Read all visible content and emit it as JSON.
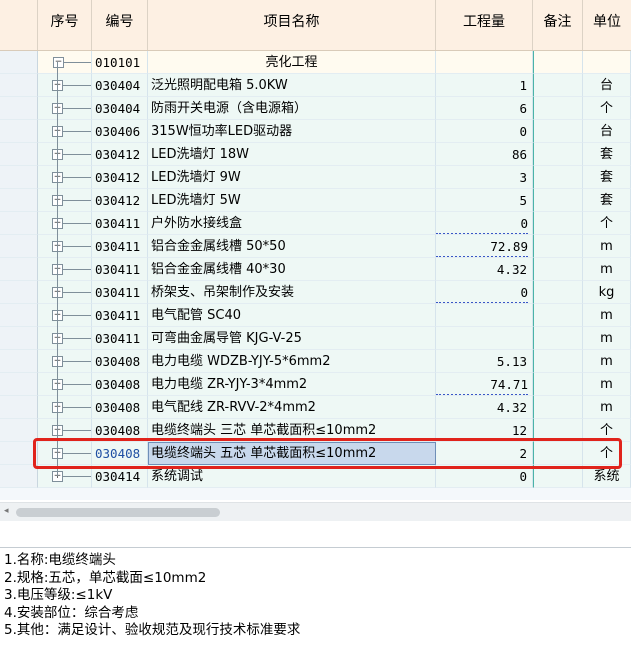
{
  "table": {
    "headers": {
      "seq": "序号",
      "code": "编号",
      "name": "项目名称",
      "quantity": "工程量",
      "remark": "备注",
      "unit": "单位"
    },
    "group": {
      "code": "010101",
      "name": "亮化工程"
    },
    "rows": [
      {
        "code": "030404",
        "name": "泛光照明配电箱 5.0KW",
        "quantity": "1",
        "unit": "台"
      },
      {
        "code": "030404",
        "name": "防雨开关电源（含电源箱）",
        "quantity": "6",
        "unit": "个"
      },
      {
        "code": "030406",
        "name": "315W恒功率LED驱动器",
        "quantity": "0",
        "unit": "台"
      },
      {
        "code": "030412",
        "name": "LED洗墙灯 18W",
        "quantity": "86",
        "unit": "套"
      },
      {
        "code": "030412",
        "name": "LED洗墙灯 9W",
        "quantity": "3",
        "unit": "套"
      },
      {
        "code": "030412",
        "name": "LED洗墙灯 5W",
        "quantity": "5",
        "unit": "套"
      },
      {
        "code": "030411",
        "name": "户外防水接线盒",
        "quantity": "0",
        "unit": "个"
      },
      {
        "code": "030411",
        "name": "铝合金金属线槽 50*50",
        "quantity": "72.89",
        "unit": "m"
      },
      {
        "code": "030411",
        "name": "铝合金金属线槽 40*30",
        "quantity": "4.32",
        "unit": "m"
      },
      {
        "code": "030411",
        "name": "桥架支、吊架制作及安装",
        "quantity": "0",
        "unit": "kg"
      },
      {
        "code": "030411",
        "name": "电气配管 SC40",
        "quantity": "",
        "unit": "m"
      },
      {
        "code": "030411",
        "name": "可弯曲金属导管 KJG-V-25",
        "quantity": "",
        "unit": "m"
      },
      {
        "code": "030408",
        "name": "电力电缆 WDZB-YJY-5*6mm2",
        "quantity": "5.13",
        "unit": "m"
      },
      {
        "code": "030408",
        "name": "电力电缆 ZR-YJY-3*4mm2",
        "quantity": "74.71",
        "unit": "m"
      },
      {
        "code": "030408",
        "name": "电气配线 ZR-RVV-2*4mm2",
        "quantity": "4.32",
        "unit": "m"
      },
      {
        "code": "030408",
        "name": "电缆终端头 三芯 单芯截面积≤10mm2",
        "quantity": "12",
        "unit": "个"
      },
      {
        "code": "030408",
        "name": "电缆终端头 五芯 单芯截面积≤10mm2",
        "quantity": "2",
        "unit": "个"
      },
      {
        "code": "030414",
        "name": "系统调试",
        "quantity": "0",
        "unit": "系统"
      }
    ]
  },
  "description": {
    "lines": [
      "1.名称:电缆终端头",
      "2.规格:五芯，单芯截面≤10mm2",
      "3.电压等级:≤1kV",
      "4.安装部位：综合考虑",
      "5.其他：满足设计、验收规范及现行技术标准要求"
    ]
  },
  "colors": {
    "header_bg": "#fdf0e3",
    "row_green": "#eef8f5",
    "highlight_border": "#e0231b",
    "selected_cell": "#c8d8ec"
  }
}
